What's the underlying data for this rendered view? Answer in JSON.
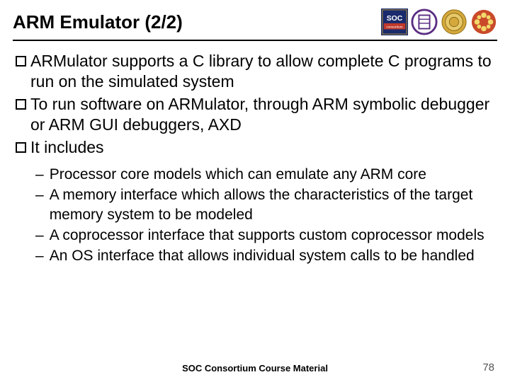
{
  "header": {
    "title": "ARM Emulator (2/2)"
  },
  "logos": {
    "soc_label": "SOC",
    "soc_sub": "consortium"
  },
  "bullets": [
    "ARMulator supports a C library to allow complete C programs to run on the simulated system",
    "To run software on ARMulator, through ARM symbolic debugger or ARM GUI debuggers, AXD",
    "It includes"
  ],
  "sub_bullets": [
    "Processor core models which can emulate any ARM core",
    "A memory interface which allows the characteristics of the target memory system to be modeled",
    "A coprocessor interface that supports custom coprocessor models",
    "An OS interface that allows individual system calls to be handled"
  ],
  "footer": "SOC Consortium Course Material",
  "page_number": "78"
}
